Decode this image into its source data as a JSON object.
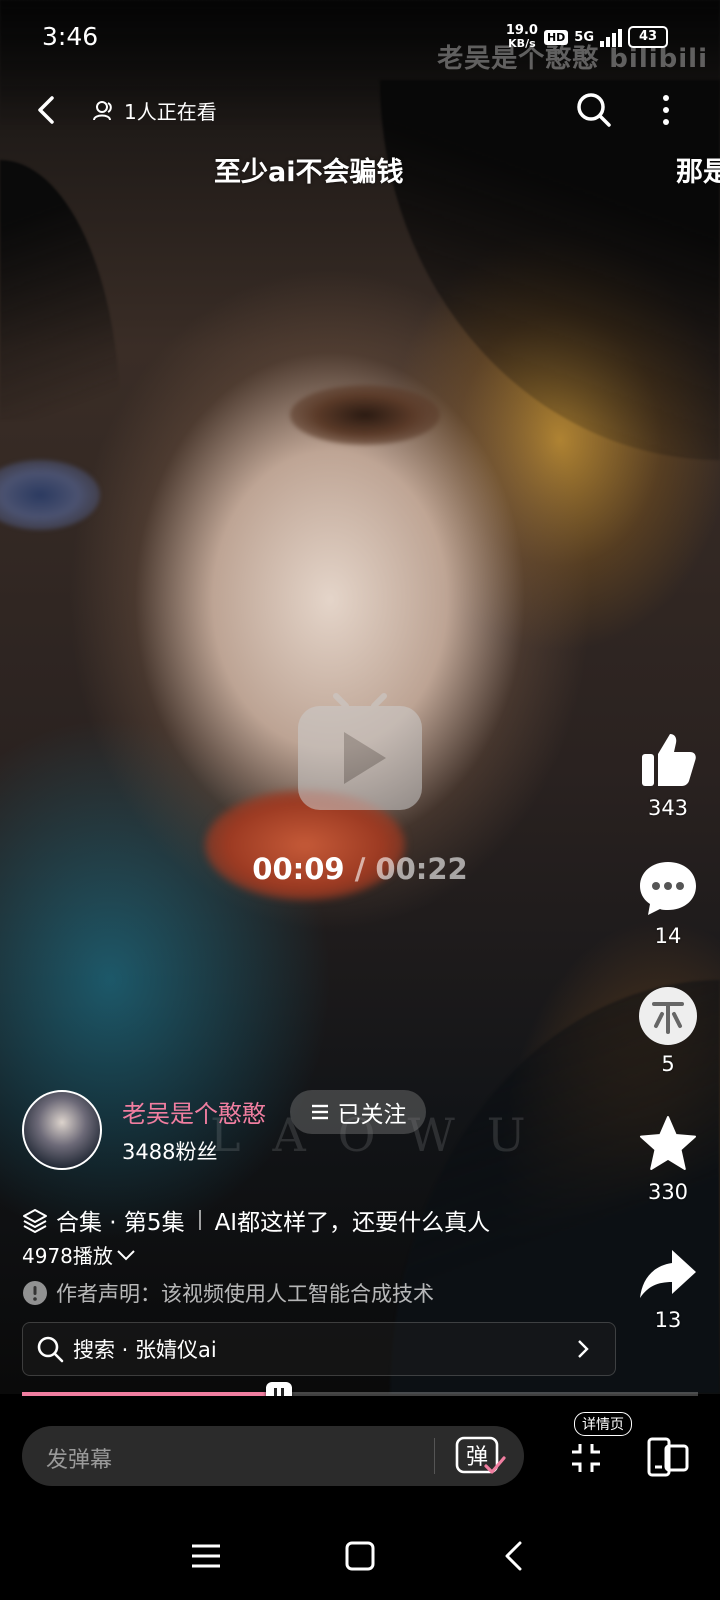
{
  "status_bar": {
    "time": "3:46",
    "net_speed_value": "19.0",
    "net_speed_unit": "KB/s",
    "hd_label": "HD",
    "network": "5G",
    "battery": "43"
  },
  "watermark": "老吴是个憨憨 bilibili",
  "top_bar": {
    "viewers": "1人正在看",
    "icons": [
      "back-icon",
      "people-icon",
      "search-icon",
      "more-icon"
    ]
  },
  "danmaku": [
    "至少ai不会骗钱",
    "那是"
  ],
  "player": {
    "current_time": "00:09",
    "separator": "/",
    "duration": "00:22",
    "progress_fraction": 0.38
  },
  "actions": {
    "likes": "343",
    "comments": "14",
    "coins": "5",
    "favorites": "330",
    "shares": "13"
  },
  "author": {
    "name": "老吴是个憨憨",
    "fans": "3488粉丝",
    "follow_label": "已关注"
  },
  "video_bg_text": "LAOWU",
  "series": {
    "label": "合集 · 第5集",
    "title": "AI都这样了，还要什么真人"
  },
  "plays": "4978播放",
  "notice": "作者声明：该视频使用人工智能合成技术",
  "search": {
    "text": "搜索 · 张婧仪ai"
  },
  "bottom_bar": {
    "danmaku_placeholder": "发弹幕",
    "danmaku_toggle": "弹",
    "detail_label": "详情页"
  },
  "colors": {
    "accent_pink": "#f07ea0",
    "background": "#000000"
  }
}
